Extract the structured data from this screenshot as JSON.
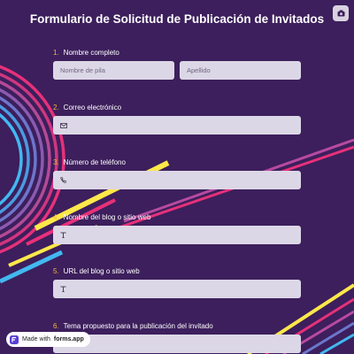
{
  "title": "Formulario de Solicitud de Publicación de Invitados",
  "questions": [
    {
      "number": "1.",
      "label": "Nombre completo",
      "first_placeholder": "Nombre de pila",
      "last_placeholder": "Apellido"
    },
    {
      "number": "2.",
      "label": "Correo electrónico",
      "icon": "envelope-icon"
    },
    {
      "number": "3.",
      "label": "Número de teléfono",
      "icon": "phone-icon"
    },
    {
      "number": "4.",
      "label": "Nombre del blog o sitio web",
      "icon": "text-icon"
    },
    {
      "number": "5.",
      "label": "URL del blog o sitio web",
      "icon": "text-icon"
    },
    {
      "number": "6.",
      "label": "Tema propuesto para la publicación del invitado"
    }
  ],
  "badge": {
    "prefix": "Made with",
    "brand": "forms.app"
  },
  "colors": {
    "background": "#3c1f5c",
    "field": "#dcd7e6",
    "number_accent": "#f4b63e",
    "stripe_yellow": "#ffe84a",
    "stripe_pink": "#e8307a",
    "stripe_blue": "#43b8f0"
  }
}
